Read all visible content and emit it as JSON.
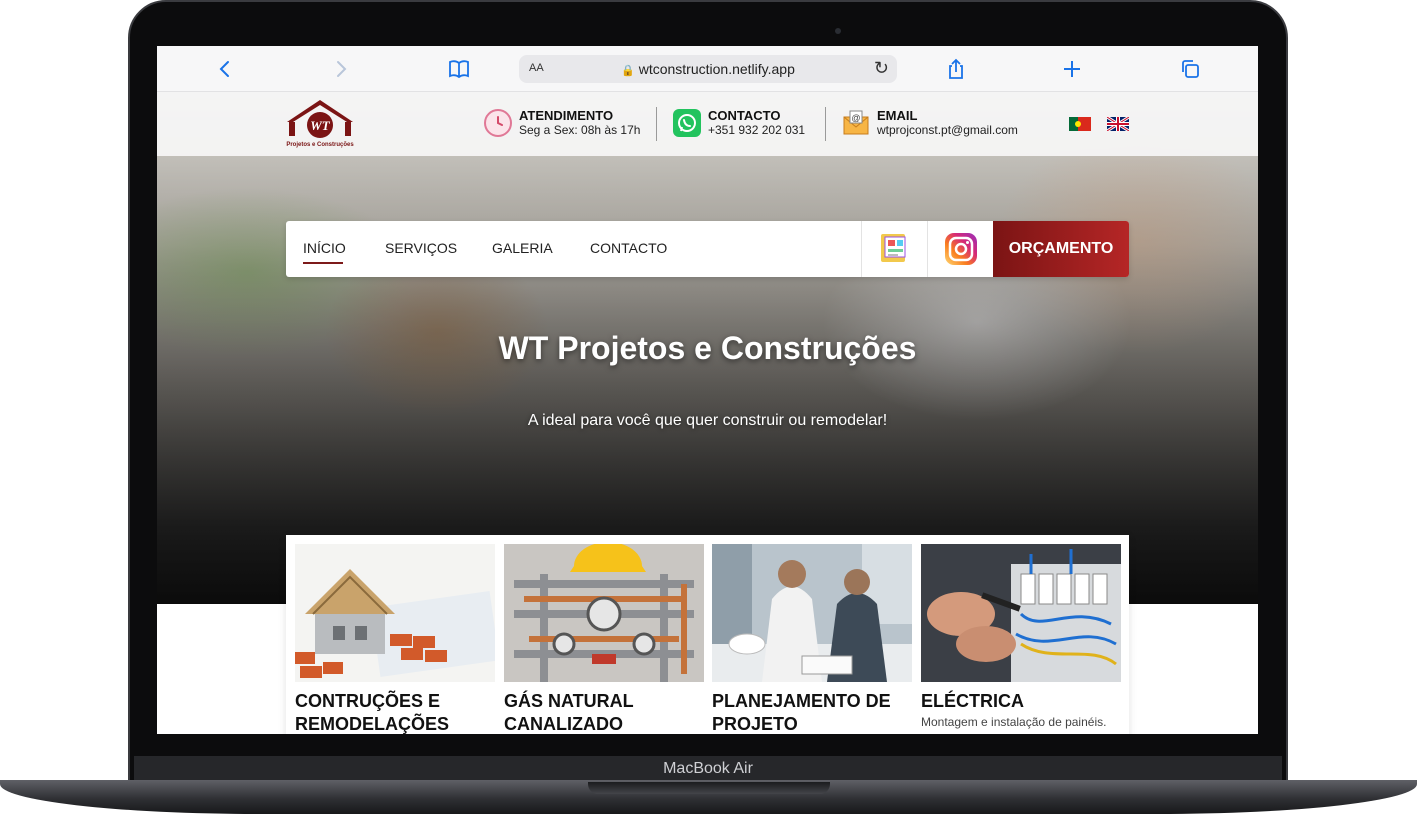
{
  "device": {
    "label": "MacBook Air"
  },
  "browser": {
    "text_size_label": "AA",
    "url": "wtconstruction.netlify.app",
    "icons": [
      "back-icon",
      "forward-icon",
      "bookmarks-icon",
      "share-icon",
      "new-tab-icon",
      "tabs-icon",
      "reload-icon",
      "lock-icon"
    ]
  },
  "header": {
    "logo": {
      "initials": "WT",
      "subtitle": "Projetos e Construções"
    },
    "atendimento": {
      "title": "ATENDIMENTO",
      "value": "Seg a Sex: 08h às 17h"
    },
    "contacto": {
      "title": "CONTACTO",
      "value": "+351 932 202 031"
    },
    "email": {
      "title": "EMAIL",
      "value": "wtprojconst.pt@gmail.com"
    },
    "languages": [
      "pt-flag-icon",
      "uk-flag-icon"
    ]
  },
  "nav": {
    "items": [
      {
        "label": "INÍCIO",
        "active": true
      },
      {
        "label": "SERVIÇOS",
        "active": false
      },
      {
        "label": "GALERIA",
        "active": false
      },
      {
        "label": "CONTACTO",
        "active": false
      }
    ],
    "cta": "ORÇAMENTO",
    "icons": [
      "portfolio-icon",
      "instagram-icon"
    ]
  },
  "hero": {
    "title": "WT Projetos e Construções",
    "subtitle": "A ideal para você que quer construir ou remodelar!"
  },
  "services": [
    {
      "title_1": "CONTRUÇÕES E",
      "title_2": "REMODELAÇÕES",
      "desc": ""
    },
    {
      "title_1": "GÁS NATURAL",
      "title_2": "CANALIZADO",
      "desc": ""
    },
    {
      "title_1": "PLANEJAMENTO DE",
      "title_2": "PROJETO",
      "desc": ""
    },
    {
      "title_1": "ELÉCTRICA",
      "title_2": "",
      "desc": "Montagem e instalação de painéis."
    }
  ],
  "colors": {
    "brand": "#7b1414",
    "link": "#1a73e8"
  }
}
